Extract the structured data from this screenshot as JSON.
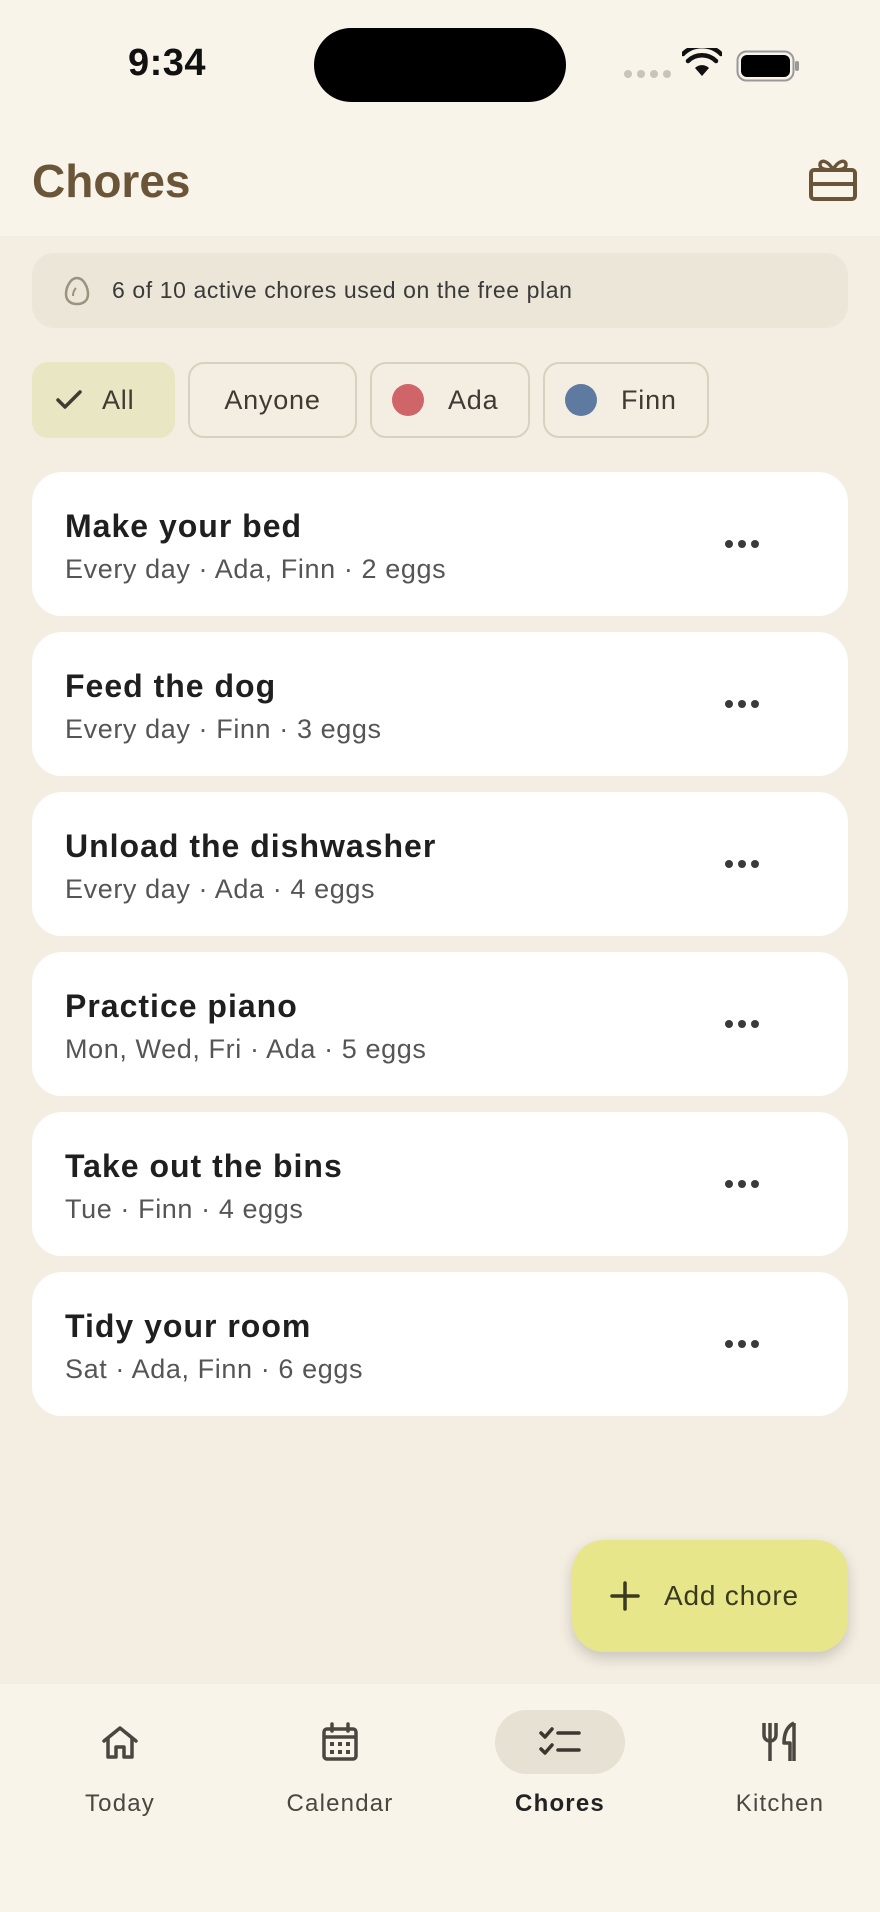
{
  "status_bar": {
    "time": "9:34"
  },
  "header": {
    "title": "Chores"
  },
  "banner": {
    "text": "6 of 10 active chores used on the free plan"
  },
  "filters": [
    {
      "label": "All",
      "selected": true
    },
    {
      "label": "Anyone"
    },
    {
      "label": "Ada",
      "color": "#cf6469"
    },
    {
      "label": "Finn",
      "color": "#5e7aa1"
    }
  ],
  "chores": [
    {
      "title": "Make your bed",
      "meta": "Every day · Ada, Finn · 2 eggs"
    },
    {
      "title": "Feed the dog",
      "meta": "Every day · Finn · 3 eggs"
    },
    {
      "title": "Unload the dishwasher",
      "meta": "Every day · Ada · 4 eggs"
    },
    {
      "title": "Practice piano",
      "meta": "Mon, Wed, Fri · Ada · 5 eggs"
    },
    {
      "title": "Take out the bins",
      "meta": "Tue · Finn · 4 eggs"
    },
    {
      "title": "Tidy your room",
      "meta": "Sat · Ada, Finn · 6 eggs"
    }
  ],
  "fab": {
    "label": "Add chore"
  },
  "nav": {
    "items": [
      {
        "label": "Today",
        "icon": "home-icon"
      },
      {
        "label": "Calendar",
        "icon": "calendar-icon"
      },
      {
        "label": "Chores",
        "icon": "checklist-icon",
        "active": true
      },
      {
        "label": "Kitchen",
        "icon": "fork-knife-icon"
      }
    ]
  },
  "colors": {
    "accent": "#e8e68b",
    "title": "#6b5539",
    "background": "#f4eee2"
  }
}
